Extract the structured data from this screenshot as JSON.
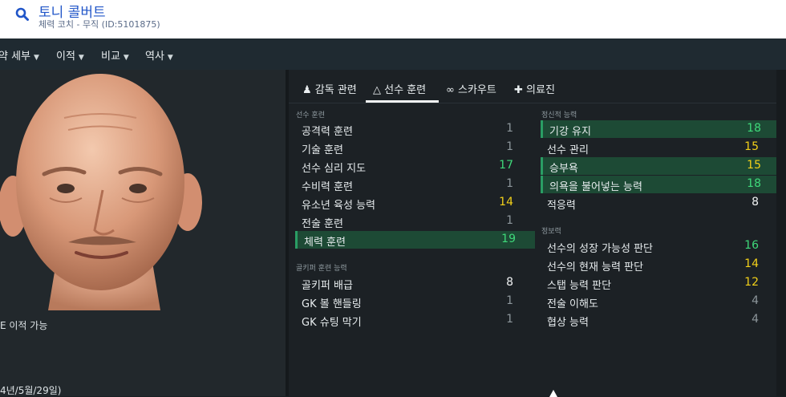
{
  "header": {
    "name": "토니 콜버트",
    "subtitle": "체력 코치 - 무직 (ID:5101875)"
  },
  "nav": {
    "items": [
      {
        "label": "약 세부"
      },
      {
        "label": "이적"
      },
      {
        "label": "비교"
      },
      {
        "label": "역사"
      }
    ]
  },
  "left": {
    "transfer_text": "E 이적 가능",
    "dob_text": "4년/5월/29일)"
  },
  "tabs": [
    {
      "label": "감독 관련",
      "icon": "coach-icon"
    },
    {
      "label": "선수 훈련",
      "icon": "training-icon",
      "active": true
    },
    {
      "label": "스카우트",
      "icon": "binoculars-icon"
    },
    {
      "label": "의료진",
      "icon": "medical-kit-icon"
    }
  ],
  "training": {
    "section_label": "선수 훈련",
    "rows": [
      {
        "name": "공격력 훈련",
        "value": "1",
        "color": "grey"
      },
      {
        "name": "기술 훈련",
        "value": "1",
        "color": "grey"
      },
      {
        "name": "선수 심리 지도",
        "value": "17",
        "color": "green"
      },
      {
        "name": "수비력 훈련",
        "value": "1",
        "color": "grey"
      },
      {
        "name": "유소년 육성 능력",
        "value": "14",
        "color": "yellow"
      },
      {
        "name": "전술 훈련",
        "value": "1",
        "color": "grey"
      },
      {
        "name": "체력 훈련",
        "value": "19",
        "color": "green",
        "highlight": true
      }
    ]
  },
  "goalkeeping": {
    "section_label": "골키퍼 훈련 능력",
    "rows": [
      {
        "name": "골키퍼 배급",
        "value": "8",
        "color": "white"
      },
      {
        "name": "GK 볼 핸들링",
        "value": "1",
        "color": "grey"
      },
      {
        "name": "GK 슈팅 막기",
        "value": "1",
        "color": "grey"
      }
    ]
  },
  "mental": {
    "section_label": "정신적 능력",
    "rows": [
      {
        "name": "기강 유지",
        "value": "18",
        "color": "green",
        "highlight": true
      },
      {
        "name": "선수 관리",
        "value": "15",
        "color": "yellow"
      },
      {
        "name": "승부욕",
        "value": "15",
        "color": "yellow",
        "highlight": true
      },
      {
        "name": "의욕을 불어넣는 능력",
        "value": "18",
        "color": "green",
        "highlight": true
      },
      {
        "name": "적응력",
        "value": "8",
        "color": "white"
      }
    ]
  },
  "knowledge": {
    "section_label": "정보력",
    "rows": [
      {
        "name": "선수의 성장 가능성 판단",
        "value": "16",
        "color": "green"
      },
      {
        "name": "선수의 현재 능력 판단",
        "value": "14",
        "color": "yellow"
      },
      {
        "name": "스탭 능력 판단",
        "value": "12",
        "color": "yellow"
      },
      {
        "name": "전술 이해도",
        "value": "4",
        "color": "grey"
      },
      {
        "name": "협상 능력",
        "value": "4",
        "color": "grey"
      }
    ]
  },
  "colors": {
    "green": "#3fd97a",
    "yellow": "#f2d019",
    "white": "#f0f2f3",
    "grey": "#8d969b",
    "highlight_bg": "#1d4a35",
    "header_link": "#2055c8"
  }
}
